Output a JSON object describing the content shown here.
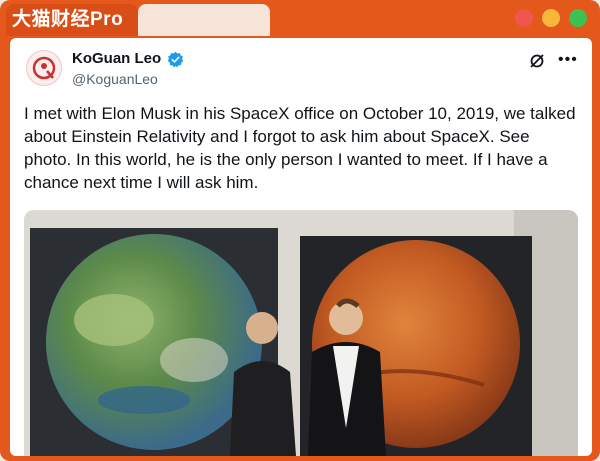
{
  "brand": {
    "label": "大猫财经Pro"
  },
  "window": {
    "controls": [
      "close",
      "minimize",
      "maximize"
    ]
  },
  "tweet": {
    "author_name": "KoGuan Leo",
    "handle": "@KoguanLeo",
    "verified": true,
    "text": "I met with Elon Musk in his SpaceX office on October 10, 2019, we talked about Einstein Relativity and I forgot to ask him about SpaceX. See photo. In this world, he is the only person I wanted to meet. If I have a chance next time I will ask him."
  },
  "photo": {
    "subject": "two men standing in front of Earth and Mars paintings"
  },
  "colors": {
    "frame": "#e4581b",
    "verified": "#1d9bf0",
    "text": "#0f1419",
    "secondary_text": "#536471"
  },
  "icons": [
    "avatar",
    "verified-badge-icon",
    "grok-icon",
    "more-icon"
  ]
}
